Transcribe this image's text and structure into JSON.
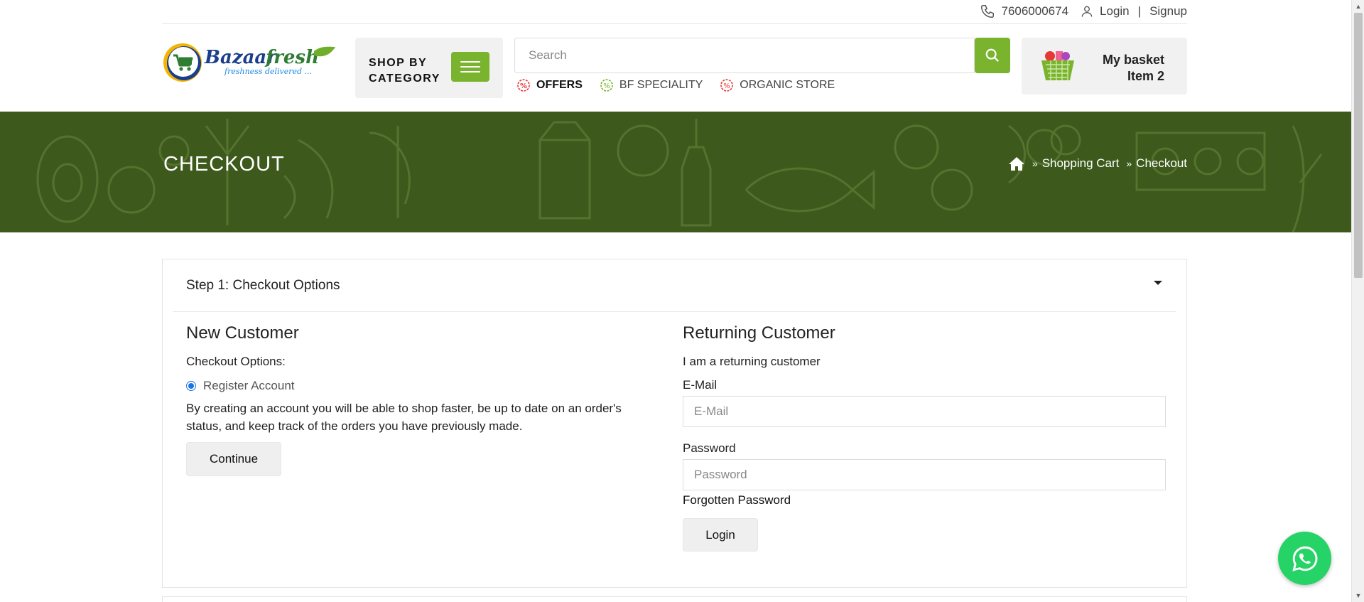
{
  "topbar": {
    "phone": "7606000674",
    "login": "Login",
    "separator": "|",
    "signup": "Signup"
  },
  "header": {
    "logo_text": "Bazaarfresh",
    "logo_tagline": "freshness delivered ...",
    "shop_by_line1": "SHOP BY",
    "shop_by_line2": "CATEGORY",
    "search_placeholder": "Search",
    "quick_links": [
      {
        "label": "OFFERS"
      },
      {
        "label": "BF SPECIALITY"
      },
      {
        "label": "ORGANIC STORE"
      }
    ],
    "basket_title": "My basket",
    "basket_items": "Item 2"
  },
  "banner": {
    "title": "CHECKOUT",
    "breadcrumb": [
      "Shopping Cart",
      "Checkout"
    ]
  },
  "checkout": {
    "step_title": "Step 1: Checkout Options",
    "new_customer": {
      "heading": "New Customer",
      "options_label": "Checkout Options:",
      "radio_label": "Register Account",
      "description": "By creating an account you will be able to shop faster, be up to date on an order's status, and keep track of the orders you have previously made.",
      "continue_label": "Continue"
    },
    "returning_customer": {
      "heading": "Returning Customer",
      "subtitle": "I am a returning customer",
      "email_label": "E-Mail",
      "email_placeholder": "E-Mail",
      "password_label": "Password",
      "password_placeholder": "Password",
      "forgot_label": "Forgotten Password",
      "login_label": "Login"
    }
  },
  "colors": {
    "brand_green": "#7ab42e",
    "banner_green": "#3d5a1c",
    "whatsapp": "#25d366"
  }
}
